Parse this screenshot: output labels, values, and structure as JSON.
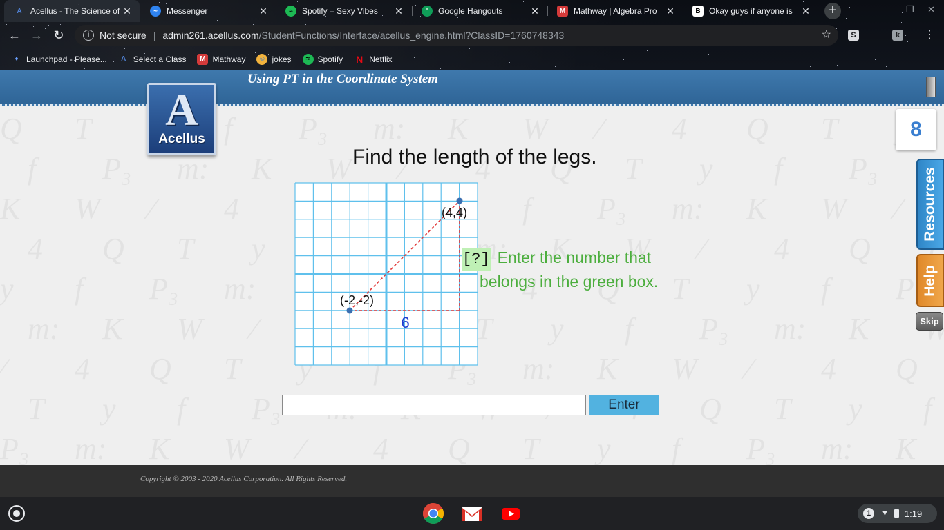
{
  "browser": {
    "tabs": [
      {
        "title": "Acellus - The Science of",
        "icon": "acellus-icon",
        "active": true
      },
      {
        "title": "Messenger",
        "icon": "messenger-icon",
        "active": false
      },
      {
        "title": "Spotify – Sexy Vibes",
        "icon": "spotify-icon",
        "active": false
      },
      {
        "title": "Google Hangouts",
        "icon": "hangouts-icon",
        "active": false
      },
      {
        "title": "Mathway | Algebra Pro",
        "icon": "mathway-icon",
        "active": false
      },
      {
        "title": "Okay guys if anyone is",
        "icon": "brainly-icon",
        "active": false
      }
    ],
    "close_glyph": "✕",
    "new_tab_glyph": "+",
    "address": {
      "security_label": "Not secure",
      "host": "admin261.acellus.com",
      "path": "/StudentFunctions/Interface/acellus_engine.html?ClassID=1760748343"
    },
    "bookmarks": [
      {
        "label": "Launchpad - Please...",
        "icon": "launchpad-icon"
      },
      {
        "label": "Select a Class",
        "icon": "acellus-icon"
      },
      {
        "label": "Mathway",
        "icon": "mathway-icon"
      },
      {
        "label": "jokes",
        "icon": "jokes-icon"
      },
      {
        "label": "Spotify",
        "icon": "spotify-icon"
      },
      {
        "label": "Netflix",
        "icon": "netflix-icon"
      }
    ]
  },
  "lesson": {
    "title": "Using PT in the Coordinate System",
    "logo_letter": "A",
    "logo_text": "Acellus",
    "question": "Find the length of the legs.",
    "graph": {
      "point_a_label": "(-2,-2)",
      "point_b_label": "(4,4)",
      "horizontal_leg_label": "6",
      "grid_min": -6,
      "grid_max": 4
    },
    "prompt_box": "[?]",
    "prompt_line1": "Enter the number that",
    "prompt_line2": "belongs in the green box.",
    "answer_value": "",
    "enter_label": "Enter",
    "counter": "8",
    "resources_label": "Resources",
    "help_label": "Help",
    "skip_label": "Skip",
    "copyright": "Copyright © 2003 - 2020 Acellus Corporation.  All Rights Reserved.",
    "colors": {
      "header_blue": "#3f79ad",
      "prompt_green": "#4cae3e",
      "grid_blue": "#5fc0ec",
      "triangle_red": "#e23a3a"
    }
  },
  "shelf": {
    "apps": [
      "chrome-icon",
      "gmail-icon",
      "youtube-icon"
    ],
    "notification_count": "1",
    "time": "1:19"
  }
}
